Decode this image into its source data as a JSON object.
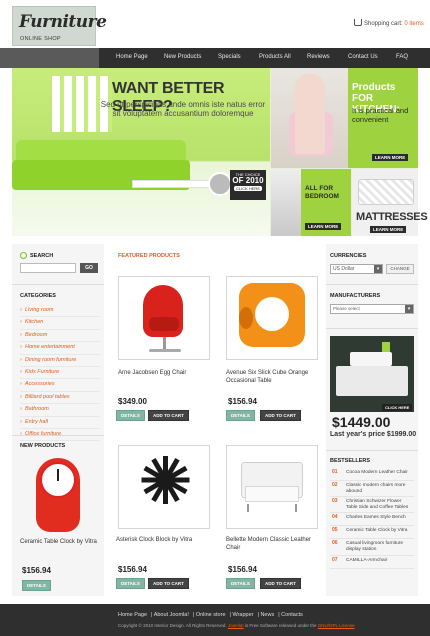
{
  "brand": {
    "title": "Furniture",
    "subtitle": "ONLINE SHOP"
  },
  "cart": {
    "label": "Shopping cart:",
    "count": "0 items"
  },
  "nav": [
    "Home Page",
    "New Products",
    "Specials",
    "Products All",
    "Reviews",
    "Contact Us",
    "FAQ"
  ],
  "hero": {
    "title": "WANT BETTER SLEEP?",
    "text": "Sed ut perspiciatis unde omnis iste natus error sit voluptatem accusantium doloremque",
    "choice_line1": "THE CHOICE",
    "choice_line2": "OF 2010",
    "choice_button": "CLICK HERE",
    "kitchen_title": "Products FOR KITCHEN:",
    "kitchen_sub": "It is practical and convenient",
    "kitchen_more": "LEARN MORE",
    "bedroom_title": "ALL FOR BEDROOM",
    "bedroom_more": "LEARN MORE",
    "mattress_title": "MATTRESSES",
    "mattress_more": "LEARN MORE"
  },
  "search": {
    "title": "SEARCH",
    "button": "GO",
    "placeholder": ""
  },
  "categories": {
    "title": "CATEGORIES",
    "items": [
      "Living room",
      "Kitchen",
      "Bedroom",
      "Home entertainment",
      "Dining room furniture",
      "Kids Furniture",
      "Accessories",
      "Billiard pool tables",
      "Bathroom",
      "Entry hall",
      "Office furniture"
    ]
  },
  "new_products": {
    "title": "NEW PRODUCTS",
    "name": "Ceramic Table Clock by Vitra",
    "price": "$156.94",
    "details": "DETAILS"
  },
  "featured": {
    "title": "FEATURED PRODUCTS",
    "products": [
      {
        "name": "Arne Jacobsen Egg Chair",
        "price": "$349.00",
        "details": "DETAILS",
        "cart": "ADD TO CART"
      },
      {
        "name": "Avenue Six Slick Cube Orange Occasional Table",
        "price": "$156.94",
        "details": "DETAILS",
        "cart": "ADD TO CART"
      },
      {
        "name": "Asterisk Clock Block by Vitra",
        "price": "$156.94",
        "details": "DETAILS",
        "cart": "ADD TO CART"
      },
      {
        "name": "Bellette Modern Classic Leather Chair",
        "price": "$156.94",
        "details": "DETAILS",
        "cart": "ADD TO CART"
      }
    ]
  },
  "currencies": {
    "title": "CURRENCIES",
    "selected": "US Dollar",
    "button": "CHANGE"
  },
  "manufacturers": {
    "title": "MANUFACTURERS",
    "selected": "Please select"
  },
  "promo": {
    "click": "CLICK HERE",
    "price": "$1449.00",
    "last_year": "Last year's price $1999.00"
  },
  "bestsellers": {
    "title": "BESTSELLERS",
    "items": [
      {
        "num": "01",
        "name": "Cocoa Modern Leather Chair"
      },
      {
        "num": "02",
        "name": "Classic modern chairs more abound"
      },
      {
        "num": "03",
        "name": "Christian Schwizer Flower Table Side and Coffee Tables"
      },
      {
        "num": "04",
        "name": "Charles Eames Style Bench"
      },
      {
        "num": "05",
        "name": "Ceramic Table Clock by Vitra"
      },
      {
        "num": "06",
        "name": "Casual livingroom furniture display station"
      },
      {
        "num": "07",
        "name": "CAMILLA-Armchair"
      }
    ]
  },
  "footer": {
    "links": [
      "Home Page",
      "About Joomla!",
      "Online store",
      "Wrapper",
      "News",
      "Contacts"
    ],
    "copy_prefix": "Copyright © 2010 Interior Design. All Rights Reserved.",
    "copy_hl1": "Joomla!",
    "copy_mid": "is Free Software released under the",
    "copy_hl2": "GNU/GPL License"
  },
  "colors": {
    "accent": "#e0601c",
    "green": "#9fd23f",
    "dark": "#2f2f2f"
  }
}
